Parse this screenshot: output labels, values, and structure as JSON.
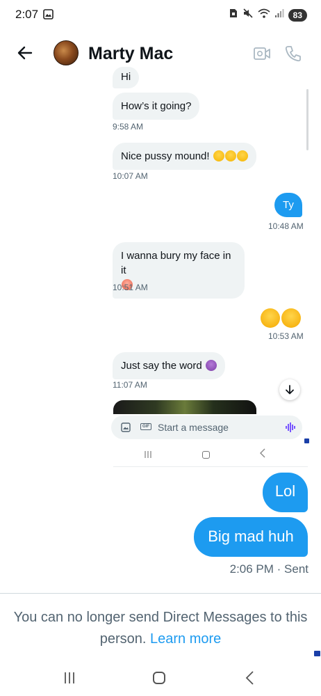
{
  "status_bar": {
    "time": "2:07",
    "battery": "83",
    "icons": [
      "gallery-icon",
      "sim-card-icon",
      "mute-icon",
      "wifi-icon",
      "signal-icon",
      "battery-icon"
    ]
  },
  "header": {
    "name": "Marty Mac",
    "icons": [
      "back-arrow-icon",
      "avatar",
      "video-call-icon",
      "phone-call-icon"
    ]
  },
  "conversation": {
    "messages": [
      {
        "direction": "in",
        "text": "Hi",
        "time": ""
      },
      {
        "direction": "in",
        "text": "How’s it going?",
        "time": "9:58 AM"
      },
      {
        "direction": "in",
        "text": "Nice pussy mound!",
        "emoji": "smiling-face-x3",
        "time": "10:07 AM"
      },
      {
        "direction": "out",
        "text": "Ty",
        "time": "10:48 AM"
      },
      {
        "direction": "in",
        "text": "I wanna bury my face in it",
        "emoji": "flushed-face",
        "time": "10:51 AM"
      },
      {
        "direction": "out",
        "text": "",
        "emoji": "smiling-face-x2",
        "time": "10:53 AM"
      },
      {
        "direction": "in",
        "text": "Just say the word",
        "emoji": "smiling-devil",
        "time": "11:07 AM"
      }
    ],
    "compose_placeholder": "Start a message",
    "compose_icons": [
      "image-icon",
      "gif-icon",
      "voice-icon"
    ]
  },
  "sent": {
    "messages": [
      {
        "direction": "out",
        "text": "Lol"
      },
      {
        "direction": "out",
        "text": "Big mad huh"
      }
    ],
    "status": "2:06 PM · Sent"
  },
  "footer": {
    "notice": "You can no longer send Direct Messages to this person.",
    "link": "Learn more"
  },
  "colors": {
    "accent": "#1d9bf0",
    "incoming_bubble": "#eff3f4",
    "muted_text": "#536471"
  }
}
